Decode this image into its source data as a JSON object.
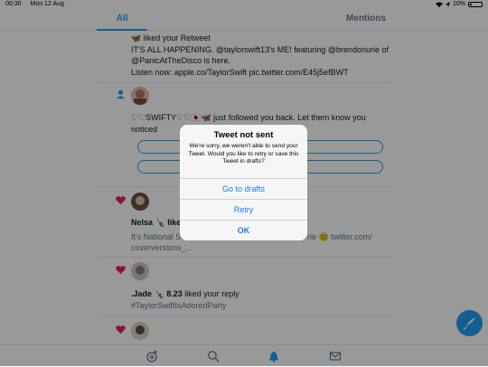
{
  "status_bar": {
    "time": "00:30",
    "date": "Mon 12 Aug",
    "battery": "10%"
  },
  "tabs": [
    {
      "label": "All",
      "active": true
    },
    {
      "label": "Mentions",
      "active": false
    }
  ],
  "notifications": [
    {
      "type": "retweet_like",
      "headline": "🦋 liked your Retweet",
      "body_lines": [
        "IT'S ALL HAPPENING. @taylorswift13's ME! featuring @brendonurie of",
        "@PanicAtTheDisco is here.",
        "Listen now: apple.co/TaylorSwift pic.twitter.com/E45j5efBWT"
      ]
    },
    {
      "type": "follow",
      "headline_lines": [
        "♡♡SWIFTY♡♡🇯🇵🦋 just followed you back. Let them know you",
        "noticed"
      ]
    },
    {
      "type": "like",
      "headline": "Nelsa 🍾 like",
      "body_left": "It's National S",
      "body_right": "rie 😊 twitter.com/",
      "body_line2": "coverversions_..."
    },
    {
      "type": "like",
      "headline_prefix": ".Jade 🍾 8.23",
      "headline_suffix": "liked your reply",
      "body": "#TaylorSwiftIsAdoredParty"
    },
    {
      "type": "like"
    }
  ],
  "alert": {
    "title": "Tweet not sent",
    "message": "We're sorry, we weren't able to send your Tweet. Would you like to retry or save this Tweet in drafts?",
    "buttons": {
      "drafts": "Go to drafts",
      "retry": "Retry",
      "ok": "OK"
    }
  },
  "colors": {
    "accent": "#1da1f2",
    "heart": "#e0245e",
    "ios_blue": "#1a7cf0"
  },
  "icons": [
    "home-icon",
    "search-icon",
    "notifications-bell-icon",
    "messages-envelope-icon",
    "compose-feather-icon"
  ]
}
